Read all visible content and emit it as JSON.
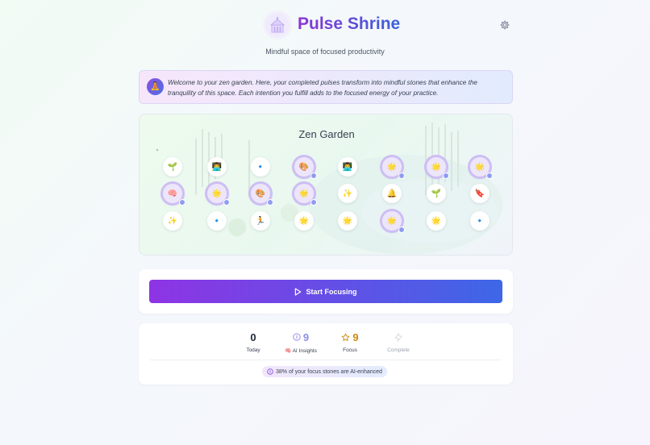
{
  "header": {
    "title": "Pulse Shrine",
    "subtitle": "Mindful space of focused productivity",
    "logo_icon": "temple-icon",
    "settings_icon": "gear-icon"
  },
  "welcome": {
    "avatar_icon": "meditation-icon",
    "text": "Welcome to your zen garden. Here, your completed pulses transform into mindful stones that enhance the tranquility of this space. Each intention you fulfill adds to the focused energy of your practice."
  },
  "garden": {
    "title": "Zen Garden",
    "stones": [
      {
        "emoji": "🌱",
        "ai": false
      },
      {
        "emoji": "👨‍💻",
        "ai": false
      },
      {
        "emoji": "🔹",
        "ai": false
      },
      {
        "emoji": "🎨",
        "ai": true
      },
      {
        "emoji": "👨‍💻",
        "ai": false
      },
      {
        "emoji": "🌟",
        "ai": true
      },
      {
        "emoji": "🌟",
        "ai": true
      },
      {
        "emoji": "🌟",
        "ai": true
      },
      {
        "emoji": "🧠",
        "ai": true
      },
      {
        "emoji": "🌟",
        "ai": true
      },
      {
        "emoji": "🎨",
        "ai": true
      },
      {
        "emoji": "🌟",
        "ai": true
      },
      {
        "emoji": "✨",
        "ai": false
      },
      {
        "emoji": "🔔",
        "ai": false
      },
      {
        "emoji": "🌱",
        "ai": false
      },
      {
        "emoji": "🔖",
        "ai": false
      },
      {
        "emoji": "✨",
        "ai": false
      },
      {
        "emoji": "🔹",
        "ai": false
      },
      {
        "emoji": "🏃",
        "ai": false
      },
      {
        "emoji": "🌟",
        "ai": false
      },
      {
        "emoji": "🌟",
        "ai": false
      },
      {
        "emoji": "🌟",
        "ai": true
      },
      {
        "emoji": "🌟",
        "ai": false
      },
      {
        "emoji": "🔹",
        "ai": false
      }
    ]
  },
  "actions": {
    "start_label": "Start Focusing",
    "start_icon": "play-icon"
  },
  "stats": {
    "today": {
      "value": "0",
      "label": "Today"
    },
    "ai_insights": {
      "value": "9",
      "label": "🧠 AI Insights",
      "icon": "info-circle-icon",
      "color": "#8b8fe0"
    },
    "focus": {
      "value": "9",
      "label": "Focus",
      "icon": "star-icon",
      "color": "#c98a12"
    },
    "complete": {
      "label": "Complete",
      "icon": "lightning-icon"
    },
    "ai_note": "38% of your focus stones are AI-enhanced"
  },
  "colors": {
    "accent_start": "#8e34e4",
    "accent_end": "#3d67e7"
  }
}
